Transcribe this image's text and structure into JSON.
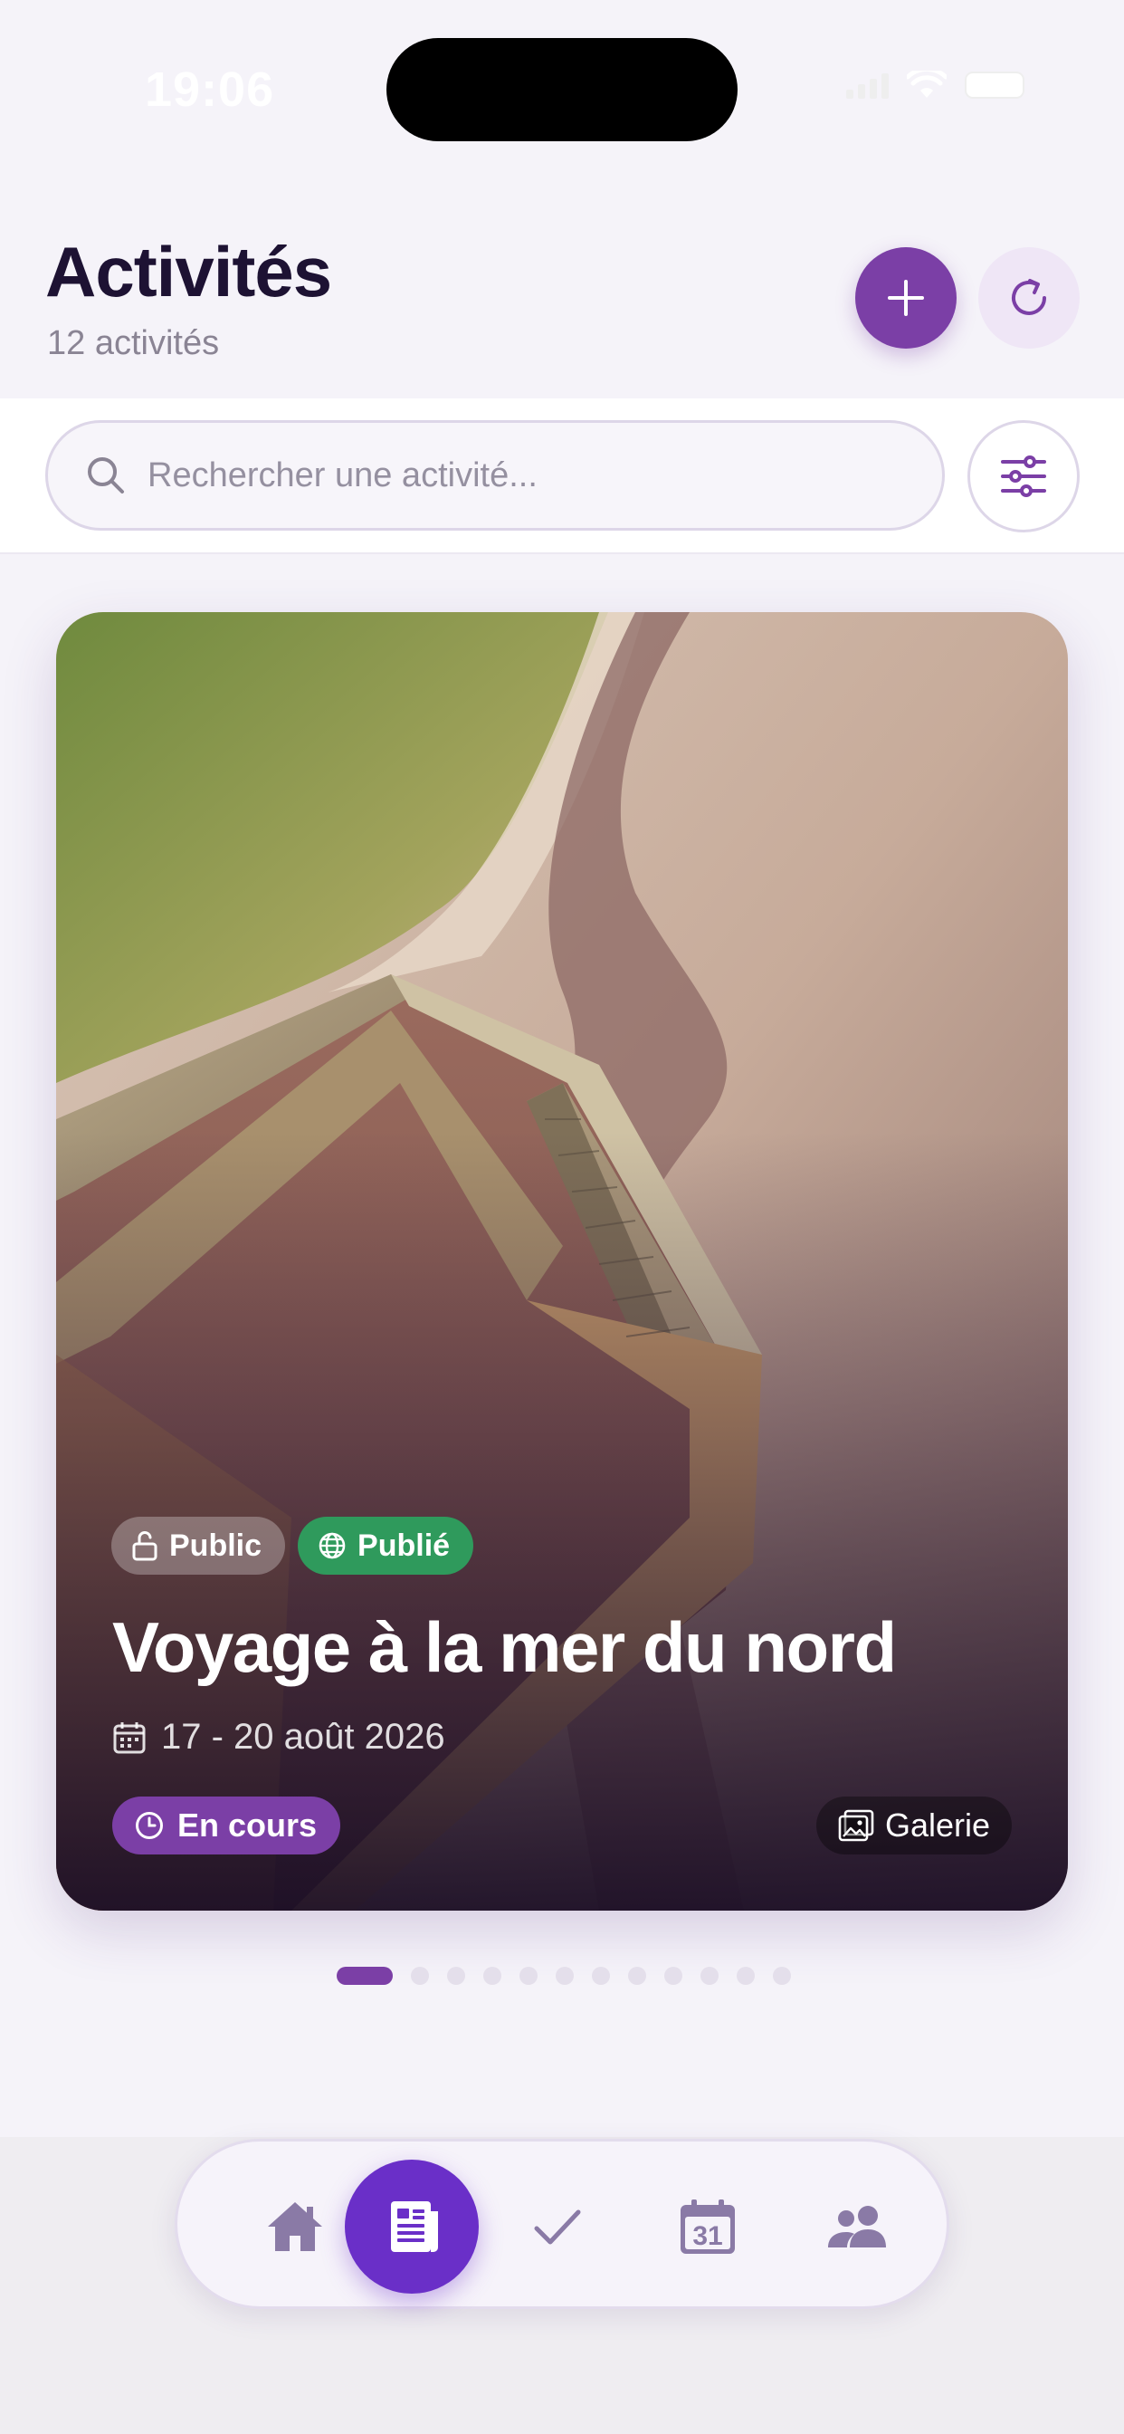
{
  "status_bar": {
    "time": "19:06"
  },
  "header": {
    "title": "Activités",
    "subtitle": "12 activités",
    "add_icon": "plus-icon",
    "refresh_icon": "refresh-icon"
  },
  "search": {
    "placeholder": "Rechercher une activité...",
    "value": "",
    "filter_icon": "sliders-icon"
  },
  "card": {
    "badges": [
      {
        "label": "Public",
        "icon": "unlock-icon"
      },
      {
        "label": "Publié",
        "icon": "globe-icon"
      }
    ],
    "title": "Voyage à la mer du nord",
    "date": "17 - 20 août 2026",
    "status": "En cours",
    "gallery_label": "Galerie"
  },
  "pager": {
    "total": 12,
    "active_index": 0
  },
  "tabbar": {
    "tabs": [
      {
        "icon": "home-icon",
        "active": false
      },
      {
        "icon": "newspaper-icon",
        "active": true
      },
      {
        "icon": "check-icon",
        "active": false
      },
      {
        "icon": "calendar-icon",
        "active": false,
        "text": "31"
      },
      {
        "icon": "people-icon",
        "active": false
      }
    ]
  },
  "colors": {
    "accent": "#7b3fa6",
    "tab_active": "#6a2fc8",
    "published_green": "#2f9a5c",
    "background": "#f5f3f9"
  }
}
